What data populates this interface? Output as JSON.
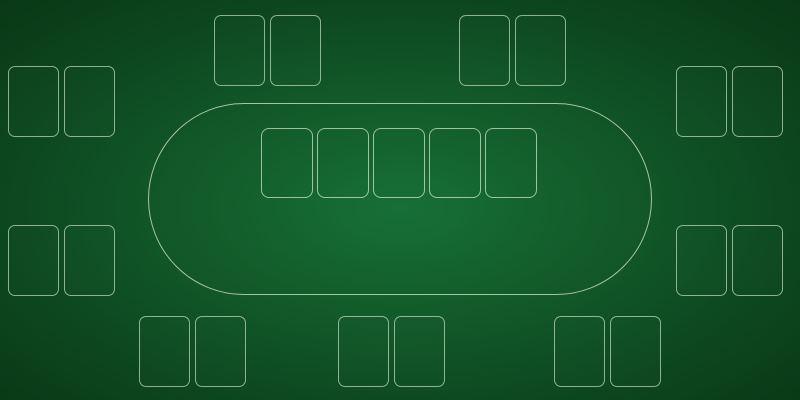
{
  "table": {
    "felt_color": "#146332",
    "line_color": "#e1f0d7"
  },
  "community_cards": {
    "slots": [
      null,
      null,
      null,
      null,
      null
    ]
  },
  "seats": [
    {
      "id": "top-left-center",
      "cards": [
        null,
        null
      ]
    },
    {
      "id": "top-right-center",
      "cards": [
        null,
        null
      ]
    },
    {
      "id": "upper-left",
      "cards": [
        null,
        null
      ]
    },
    {
      "id": "upper-right",
      "cards": [
        null,
        null
      ]
    },
    {
      "id": "lower-left",
      "cards": [
        null,
        null
      ]
    },
    {
      "id": "lower-right",
      "cards": [
        null,
        null
      ]
    },
    {
      "id": "bottom-left",
      "cards": [
        null,
        null
      ]
    },
    {
      "id": "bottom-center",
      "cards": [
        null,
        null
      ]
    },
    {
      "id": "bottom-right",
      "cards": [
        null,
        null
      ]
    }
  ]
}
